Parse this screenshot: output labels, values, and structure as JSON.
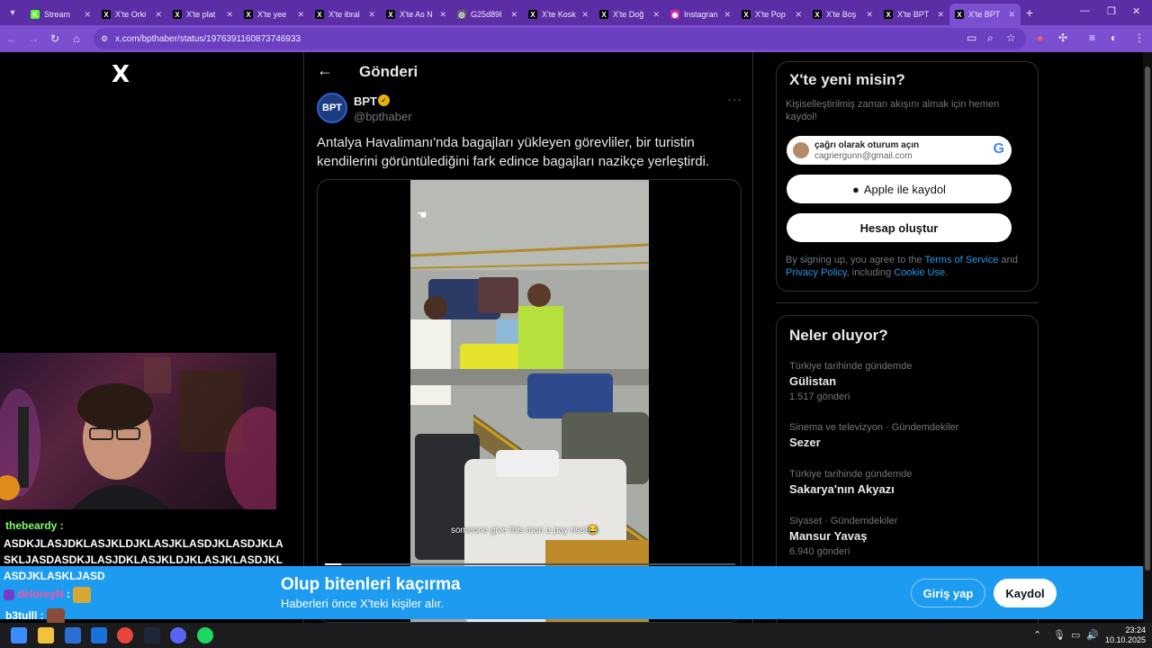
{
  "browser": {
    "tabs": [
      {
        "title": "Stream",
        "color": "#53fc18",
        "glyph": "K"
      },
      {
        "title": "X'te Orki",
        "color": "#000000",
        "glyph": "X"
      },
      {
        "title": "X'te plat",
        "color": "#000000",
        "glyph": "X"
      },
      {
        "title": "X'te yee",
        "color": "#000000",
        "glyph": "X"
      },
      {
        "title": "X'te ibral",
        "color": "#000000",
        "glyph": "X"
      },
      {
        "title": "X'te As N",
        "color": "#000000",
        "glyph": "X"
      },
      {
        "title": "G25d89I",
        "color": "#5f6368",
        "glyph": "◎"
      },
      {
        "title": "X'te Kosk",
        "color": "#000000",
        "glyph": "X"
      },
      {
        "title": "X'te Doğ",
        "color": "#000000",
        "glyph": "X"
      },
      {
        "title": "Instagran",
        "color": "#d6249f",
        "glyph": "◉"
      },
      {
        "title": "X'te Pop",
        "color": "#000000",
        "glyph": "X"
      },
      {
        "title": "X'te Boş",
        "color": "#000000",
        "glyph": "X"
      },
      {
        "title": "X'te BPT",
        "color": "#000000",
        "glyph": "X"
      },
      {
        "title": "X'te BPT",
        "color": "#000000",
        "glyph": "X",
        "active": true
      }
    ],
    "new_tab": "+",
    "url": "x.com/bpthaber/status/1976391160873746933"
  },
  "post_page": {
    "logo": "X",
    "header_title": "Gönderi",
    "author_name": "BPT",
    "author_avatar_text": "BPT",
    "author_handle": "@bpthaber",
    "more_glyph": "···",
    "text": "Antalya Havalimanı'nda bagajları yükleyen görevliler, bir turistin kendilerini görüntülediğini fark edince bagajları nazikçe yerleştirdi.",
    "video_caption": "someone give this man a pay rise!😂",
    "video_progress": 0.04
  },
  "signup_card": {
    "title": "X'te yeni misin?",
    "subtitle": "Kişiselleştirilmiş zaman akışını almak için hemen kaydol!",
    "google_line1": "çağrı olarak oturum açın",
    "google_line2": "cagriergunn@gmail.com",
    "google_logo": "G",
    "apple_label": "Apple ile kaydol",
    "create_label": "Hesap oluştur",
    "legal_pre": "By signing up, you agree to the ",
    "terms": "Terms of Service",
    "legal_and": " and ",
    "privacy": "Privacy Policy",
    "legal_incl": ", including ",
    "cookie": "Cookie Use",
    "legal_end": "."
  },
  "trends": {
    "title": "Neler oluyor?",
    "items": [
      {
        "context": "Türkiye tarihinde gündemde",
        "name": "Gülistan",
        "count": "1.517 gönderi"
      },
      {
        "context": "Sinema ve televizyon · Gündemdekiler",
        "name": "Sezer",
        "count": ""
      },
      {
        "context": "Türkiye tarihinde gündemde",
        "name": "Sakarya'nın Akyazı",
        "count": ""
      },
      {
        "context": "Siyaset · Gündemdekiler",
        "name": "Mansur Yavaş",
        "count": "6.940 gönderi"
      }
    ]
  },
  "banner": {
    "title": "Olup bitenleri kaçırma",
    "subtitle": "Haberleri önce X'teki kişiler alır.",
    "login": "Giriş yap",
    "register": "Kaydol"
  },
  "stream_chat": {
    "user1": "thebeardy :",
    "message1": "ASDKJLASJDKLASJKLDJKLASJKLASDJKLASDJKLASKLJASDASDKJLASJDKLASJKLDJKLASJKLASDJKLASDJKLASKLJASD",
    "user2": "deloreyN",
    "user2_sep": " :",
    "user3": "b3tulll :"
  },
  "taskbar": {
    "time": "23:24",
    "date": "10.10.2025"
  }
}
